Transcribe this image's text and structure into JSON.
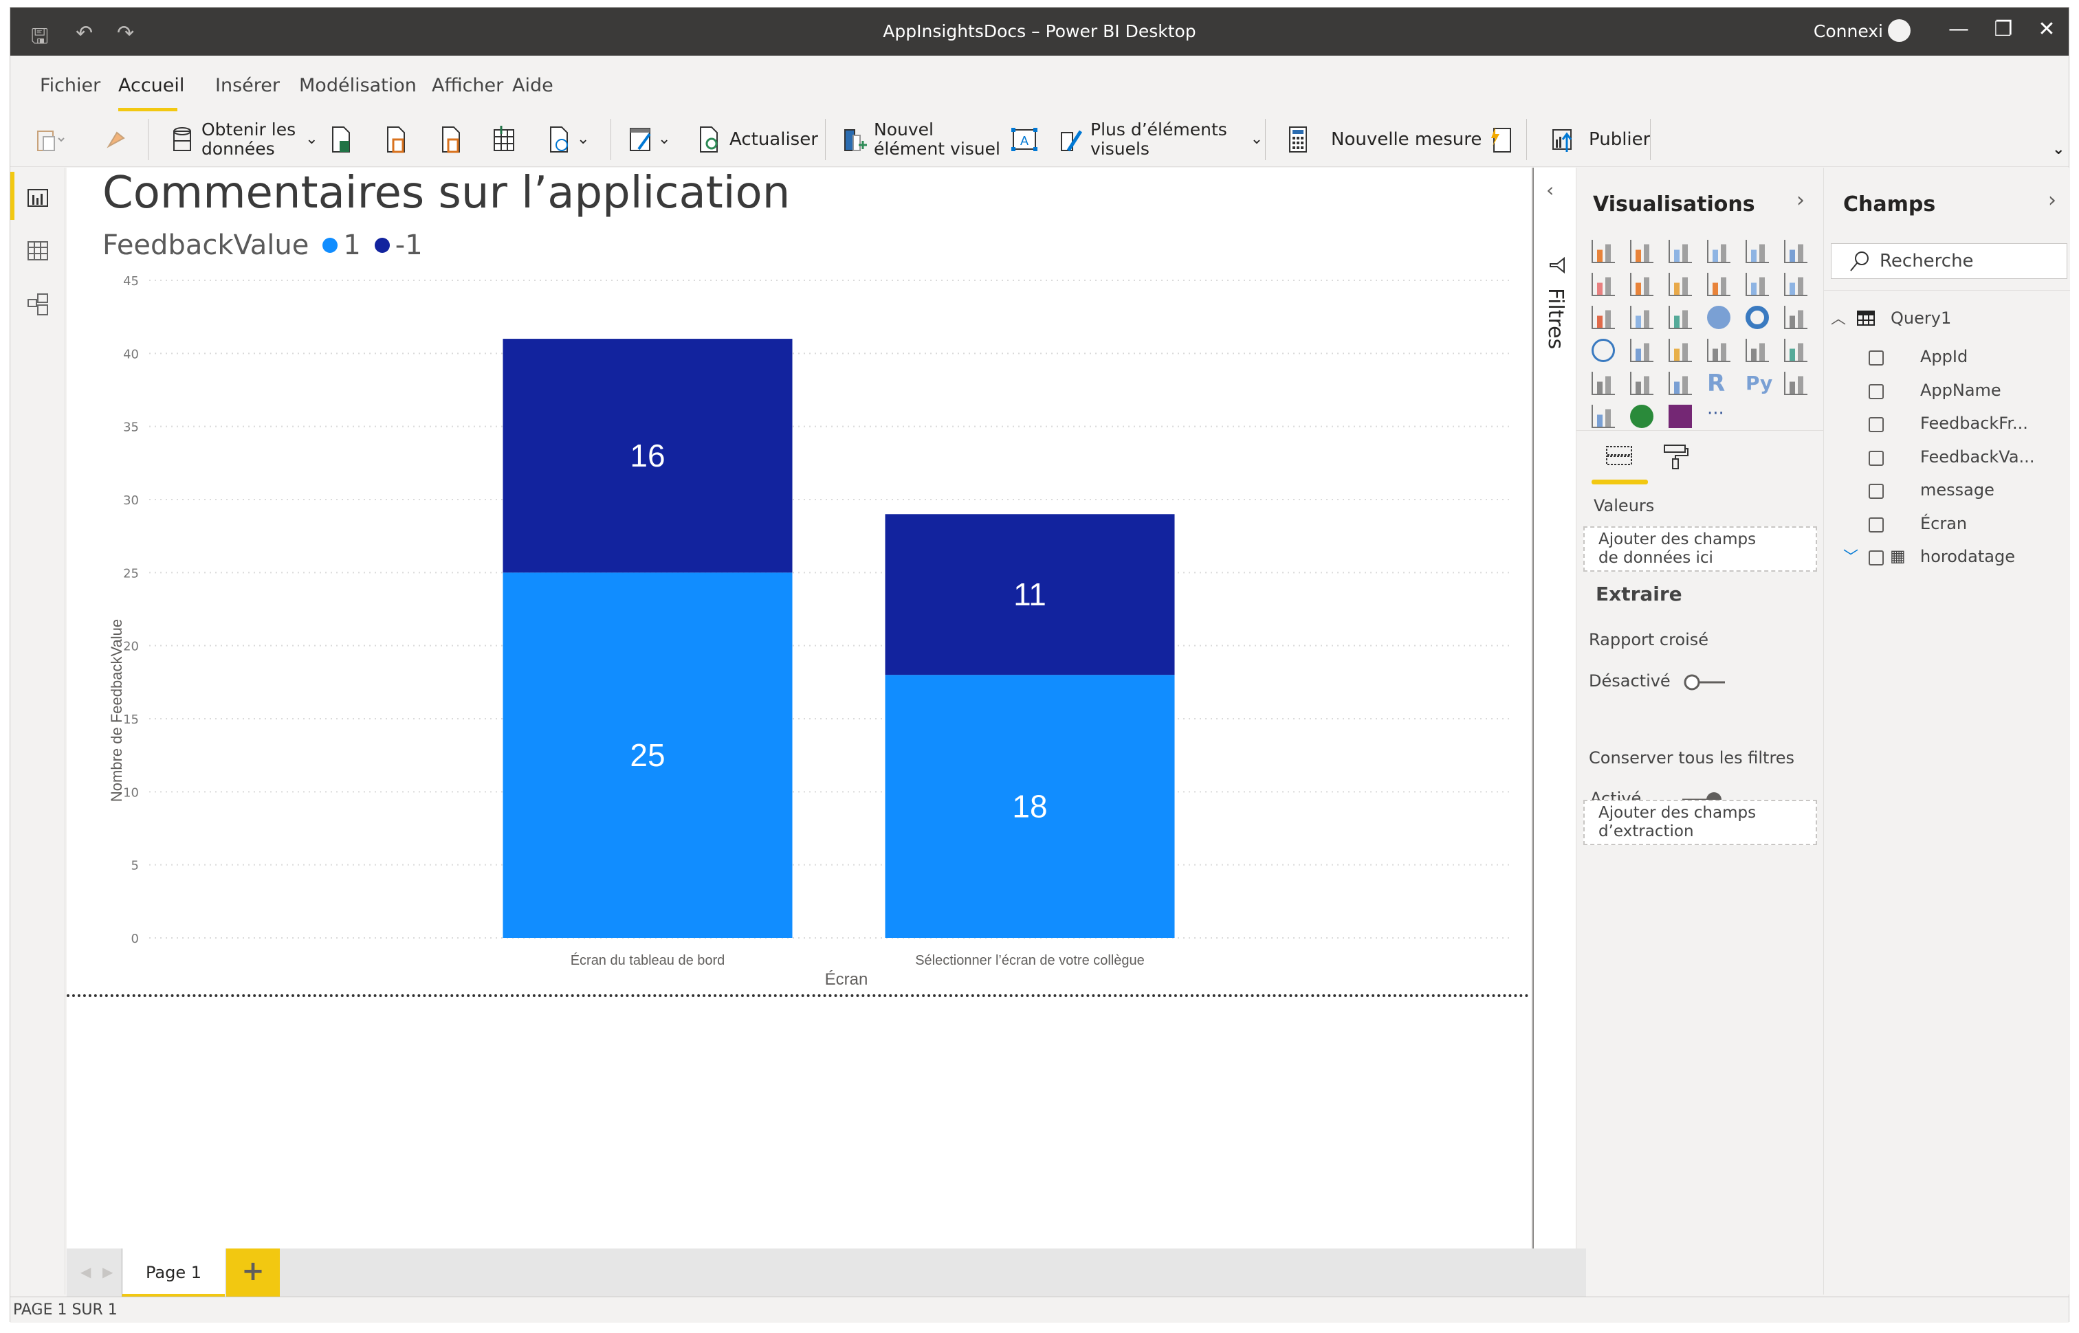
{
  "window": {
    "title": "AppInsightsDocs – Power BI Desktop",
    "signin_label": "Connexi",
    "controls": {
      "minimize": "—",
      "restore": "❐",
      "close": "✕"
    }
  },
  "menu": {
    "items": [
      "Fichier",
      "Accueil",
      "Insérer",
      "Modélisation",
      "Afficher",
      "Aide"
    ],
    "active": "Accueil"
  },
  "ribbon": {
    "get_data": [
      "Obtenir les",
      "données"
    ],
    "refresh": "Actualiser",
    "new_visual": [
      "Nouvel",
      "élément visuel"
    ],
    "more_visuals": [
      "Plus d’éléments",
      "visuels"
    ],
    "new_measure": "Nouvelle mesure",
    "publish": "Publier"
  },
  "report": {
    "title": "Commentaires sur l’application",
    "divider": true
  },
  "chart_data": {
    "type": "bar",
    "stacked": true,
    "title": "Commentaires sur l’application",
    "legend_title": "FeedbackValue",
    "legend_position": "top-left",
    "categories": [
      "Écran du tableau de bord",
      "Sélectionner l’écran de votre collègue"
    ],
    "series": [
      {
        "name": "1",
        "color": "#118DFF",
        "values": [
          25,
          18
        ]
      },
      {
        "name": "-1",
        "color": "#12239E",
        "values": [
          16,
          11
        ]
      }
    ],
    "xlabel": "Écran",
    "ylabel": "Nombre de FeedbackValue",
    "ylim": [
      0,
      45
    ],
    "yticks": [
      0,
      5,
      10,
      15,
      20,
      25,
      30,
      35,
      40,
      45
    ],
    "grid": true,
    "data_labels": true
  },
  "tabs": {
    "pages": [
      "Page 1"
    ],
    "add_label": "+",
    "status": "PAGE 1 SUR 1"
  },
  "filters": {
    "label": "Filtres"
  },
  "visualizations": {
    "title": "Visualisations",
    "more_label": "···",
    "values_label": "Valeurs",
    "values_drop": [
      "Ajouter des champs",
      "de données ici"
    ],
    "drillthrough_title": "Extraire",
    "cross_report_label": "Rapport croisé",
    "cross_report_state": "Désactivé",
    "cross_report_on": false,
    "keep_filters_label": "Conserver tous les filtres",
    "keep_filters_state": "Activé",
    "keep_filters_on": true,
    "drill_drop": [
      "Ajouter des champs",
      "d’extraction"
    ]
  },
  "fields": {
    "title": "Champs",
    "search_placeholder": "Recherche",
    "table_name": "Query1",
    "items": [
      {
        "name": "AppId",
        "checked": false
      },
      {
        "name": "AppName",
        "checked": false
      },
      {
        "name": "FeedbackFr...",
        "checked": false
      },
      {
        "name": "FeedbackVa...",
        "checked": false
      },
      {
        "name": "message",
        "checked": false
      },
      {
        "name": "Écran",
        "checked": false
      },
      {
        "name": "horodatage",
        "checked": false,
        "type": "date"
      }
    ]
  },
  "colors": {
    "accent": "#F2C811",
    "series_1": "#118DFF",
    "series_minus1": "#12239E",
    "titlebar": "#3B3A39"
  }
}
